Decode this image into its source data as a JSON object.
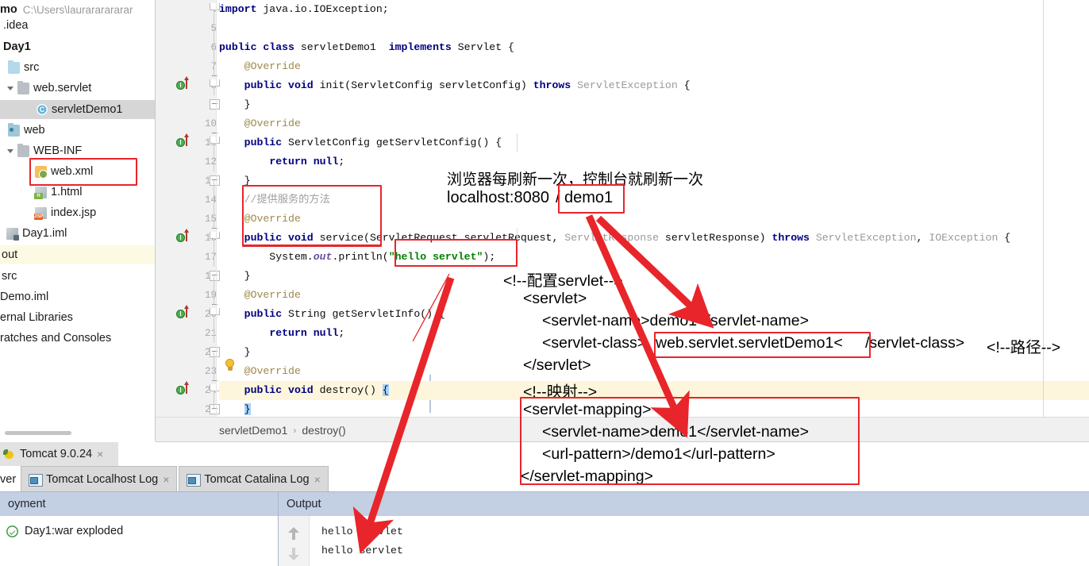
{
  "sidebar": {
    "header": {
      "project_label": "mo",
      "path": "C:\\Users\\laurararararar"
    },
    "items": [
      {
        "label": ".idea",
        "icon": "folder-icon"
      },
      {
        "label": "Day1",
        "icon": "module-icon"
      },
      {
        "label": "src",
        "icon": "folder-icon"
      },
      {
        "label": "web.servlet",
        "icon": "package-icon"
      },
      {
        "label": "servletDemo1",
        "icon": "java-class-icon"
      },
      {
        "label": "web",
        "icon": "web-folder-icon"
      },
      {
        "label": "WEB-INF",
        "icon": "folder-icon"
      },
      {
        "label": "web.xml",
        "icon": "xml-file-icon"
      },
      {
        "label": "1.html",
        "icon": "html-file-icon"
      },
      {
        "label": "index.jsp",
        "icon": "jsp-file-icon"
      },
      {
        "label": "Day1.iml",
        "icon": "iml-file-icon"
      },
      {
        "label": "out",
        "icon": "folder-icon"
      },
      {
        "label": "src",
        "icon": "folder-icon"
      },
      {
        "label": "Demo.iml",
        "icon": "iml-file-icon"
      },
      {
        "label": "ernal Libraries",
        "icon": "library-icon"
      },
      {
        "label": "ratches and Consoles",
        "icon": "scratch-icon"
      }
    ]
  },
  "editor": {
    "line_numbers": [
      "4",
      "5",
      "6",
      "7",
      "8",
      "9",
      "10",
      "11",
      "12",
      "13",
      "14",
      "15",
      "16",
      "17",
      "18",
      "19",
      "20",
      "21",
      "22",
      "23",
      "24",
      "25"
    ],
    "breadcrumb": {
      "class": "servletDemo1",
      "separator": "›",
      "member": "destroy()"
    },
    "code_lines": [
      {
        "n": "4",
        "text": "import java.io.IOException;"
      },
      {
        "n": "5",
        "text": ""
      },
      {
        "n": "6",
        "text": "public class servletDemo1  implements Servlet {"
      },
      {
        "n": "7",
        "text": "    @Override"
      },
      {
        "n": "8",
        "text": "    public void init(ServletConfig servletConfig) throws ServletException {"
      },
      {
        "n": "9",
        "text": "    }"
      },
      {
        "n": "10",
        "text": "    @Override"
      },
      {
        "n": "11",
        "text": "    public ServletConfig getServletConfig() {"
      },
      {
        "n": "12",
        "text": "        return null;"
      },
      {
        "n": "13",
        "text": "    }"
      },
      {
        "n": "14",
        "text": "    //提供服务的方法"
      },
      {
        "n": "15",
        "text": "    @Override"
      },
      {
        "n": "16",
        "text": "    public void service(ServletRequest servletRequest, ServletResponse servletResponse) throws ServletException, IOException {"
      },
      {
        "n": "17",
        "text": "        System.out.println(\"hello servlet\");"
      },
      {
        "n": "18",
        "text": "    }"
      },
      {
        "n": "19",
        "text": "    @Override"
      },
      {
        "n": "20",
        "text": "    public String getServletInfo() {"
      },
      {
        "n": "21",
        "text": "        return null;"
      },
      {
        "n": "22",
        "text": "    }"
      },
      {
        "n": "23",
        "text": "    @Override"
      },
      {
        "n": "24",
        "text": "    public void destroy() {"
      },
      {
        "n": "25",
        "text": "    }"
      }
    ]
  },
  "annotations": {
    "note_line1": "浏览器每刷新一次，控制台就刷新一次",
    "url_prefix": "localhost:8080",
    "url_slash": "/",
    "url_path": "demo1",
    "xml_comment_servlet": "<!--配置servlet-->",
    "xml_servlet_open": "<servlet>",
    "xml_servlet_name": "<servlet-name>demo1</servlet-name>",
    "xml_servlet_class_pre": "<servlet-class>",
    "xml_servlet_class_val": "web.servlet.servletDemo1<",
    "xml_servlet_class_post": "/servlet-class>",
    "xml_comment_path": "<!--路径-->",
    "xml_servlet_close": "</servlet>",
    "xml_comment_mapping": "<!--映射-->",
    "xml_mapping_open": "<servlet-mapping>",
    "xml_mapping_name": "<servlet-name>demo1</servlet-name>",
    "xml_mapping_url": "<url-pattern>/demo1</url-pattern>",
    "xml_mapping_close": "</servlet-mapping>",
    "highlight_color": "#e8252a"
  },
  "run_panel": {
    "tab_title": "Tomcat 9.0.24",
    "tab_close": "×",
    "edge_tab": "ver",
    "subtabs": [
      {
        "label": "Tomcat Localhost Log",
        "close": "×"
      },
      {
        "label": "Tomcat Catalina Log",
        "close": "×"
      }
    ],
    "deployment": {
      "header": "oyment",
      "row_label": "Day1:war exploded",
      "status_icon": "check-circle-icon"
    },
    "output": {
      "header": "Output",
      "lines": [
        "hello servlet",
        "hello servlet"
      ]
    }
  }
}
